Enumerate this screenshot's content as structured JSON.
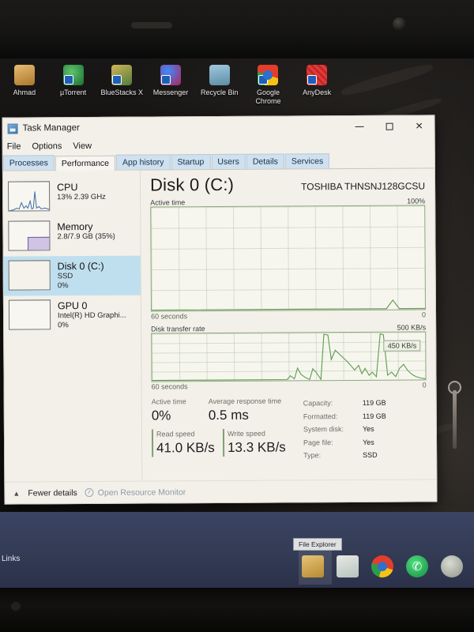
{
  "desktop": {
    "icons": [
      {
        "label": "Ahmad",
        "icon": "folder-icon"
      },
      {
        "label": "µTorrent",
        "icon": "utorrent-icon"
      },
      {
        "label": "BlueStacks X",
        "icon": "bluestacks-icon"
      },
      {
        "label": "Messenger",
        "icon": "messenger-icon"
      },
      {
        "label": "Recycle Bin",
        "icon": "recycle-bin-icon"
      },
      {
        "label": "Google Chrome",
        "icon": "chrome-icon"
      },
      {
        "label": "AnyDesk",
        "icon": "anydesk-icon"
      }
    ]
  },
  "window": {
    "title": "Task Manager",
    "controls": {
      "minimize": "–",
      "maximize": "☐",
      "close": "✕"
    },
    "menu": [
      "File",
      "Options",
      "View"
    ],
    "tabs": [
      {
        "label": "Processes",
        "active": false
      },
      {
        "label": "Performance",
        "active": true
      },
      {
        "label": "App history",
        "active": false
      },
      {
        "label": "Startup",
        "active": false
      },
      {
        "label": "Users",
        "active": false
      },
      {
        "label": "Details",
        "active": false
      },
      {
        "label": "Services",
        "active": false
      }
    ]
  },
  "sidebar": {
    "items": [
      {
        "name": "CPU",
        "sub1": "13% 2.39 GHz",
        "sub2": "",
        "selected": false,
        "thumb": "cpu-sparkline"
      },
      {
        "name": "Memory",
        "sub1": "2.8/7.9 GB (35%)",
        "sub2": "",
        "selected": false,
        "thumb": "memory-sparkline"
      },
      {
        "name": "Disk 0 (C:)",
        "sub1": "SSD",
        "sub2": "0%",
        "selected": true,
        "thumb": "disk-sparkline"
      },
      {
        "name": "GPU 0",
        "sub1": "Intel(R) HD Graphi...",
        "sub2": "0%",
        "selected": false,
        "thumb": "gpu-sparkline"
      }
    ]
  },
  "main": {
    "title": "Disk 0 (C:)",
    "model": "TOSHIBA THNSNJ128GCSU",
    "graph_active": {
      "label": "Active time",
      "max": "100%",
      "x_label": "60 seconds",
      "min": "0"
    },
    "graph_transfer": {
      "label": "Disk transfer rate",
      "max": "500 KB/s",
      "x_label": "60 seconds",
      "min": "0",
      "tooltip": "450 KB/s"
    },
    "stats": {
      "active_time_label": "Active time",
      "active_time_value": "0%",
      "avg_response_label": "Average response time",
      "avg_response_value": "0.5 ms",
      "read_speed_label": "Read speed",
      "read_speed_value": "41.0 KB/s",
      "write_speed_label": "Write speed",
      "write_speed_value": "13.3 KB/s",
      "table": [
        {
          "key": "Capacity:",
          "value": "119 GB"
        },
        {
          "key": "Formatted:",
          "value": "119 GB"
        },
        {
          "key": "System disk:",
          "value": "Yes"
        },
        {
          "key": "Page file:",
          "value": "Yes"
        },
        {
          "key": "Type:",
          "value": "SSD"
        }
      ]
    }
  },
  "footer": {
    "fewer_details": "Fewer details",
    "resource_monitor": "Open Resource Monitor"
  },
  "taskbar": {
    "links_label": "Links",
    "tooltip": "File Explorer",
    "icons": [
      {
        "name": "file-explorer-icon"
      },
      {
        "name": "microsoft-store-icon"
      },
      {
        "name": "chrome-icon"
      },
      {
        "name": "whatsapp-icon"
      },
      {
        "name": "app-icon"
      }
    ]
  },
  "chart_data": [
    {
      "type": "line",
      "title": "Active time",
      "ylabel": "Active time",
      "xlabel": "60 seconds",
      "ylim": [
        0,
        100
      ],
      "y_max_label": "100%",
      "y_min_label": "0",
      "series": [
        {
          "name": "Active time",
          "values": [
            0,
            0,
            0,
            0,
            0,
            0,
            0,
            0,
            0,
            0,
            0,
            0,
            0,
            0,
            0,
            0,
            0,
            0,
            0,
            0,
            0,
            0,
            0,
            0,
            0,
            0,
            0,
            0,
            0,
            0,
            0,
            0,
            0,
            0,
            0,
            0,
            0,
            0,
            0,
            0,
            0,
            0,
            0,
            0,
            0,
            0,
            0,
            0,
            0,
            0,
            0,
            0,
            0,
            3,
            8,
            3,
            0,
            0,
            0,
            0
          ]
        }
      ]
    },
    {
      "type": "line",
      "title": "Disk transfer rate",
      "ylabel": "Disk transfer rate",
      "xlabel": "60 seconds",
      "ylim": [
        0,
        500
      ],
      "y_max_label": "500 KB/s",
      "y_min_label": "0",
      "annotation": "450 KB/s",
      "series": [
        {
          "name": "Disk transfer rate",
          "values": [
            0,
            0,
            0,
            0,
            0,
            0,
            0,
            0,
            0,
            0,
            0,
            0,
            0,
            0,
            0,
            0,
            0,
            0,
            0,
            0,
            0,
            0,
            0,
            0,
            0,
            0,
            0,
            0,
            0,
            0,
            40,
            10,
            120,
            60,
            30,
            500,
            90,
            260,
            230,
            190,
            120,
            60,
            110,
            40,
            90,
            30,
            70,
            20,
            480,
            120,
            60,
            40,
            90,
            140,
            100,
            60,
            130,
            70,
            40,
            20
          ]
        }
      ]
    }
  ]
}
